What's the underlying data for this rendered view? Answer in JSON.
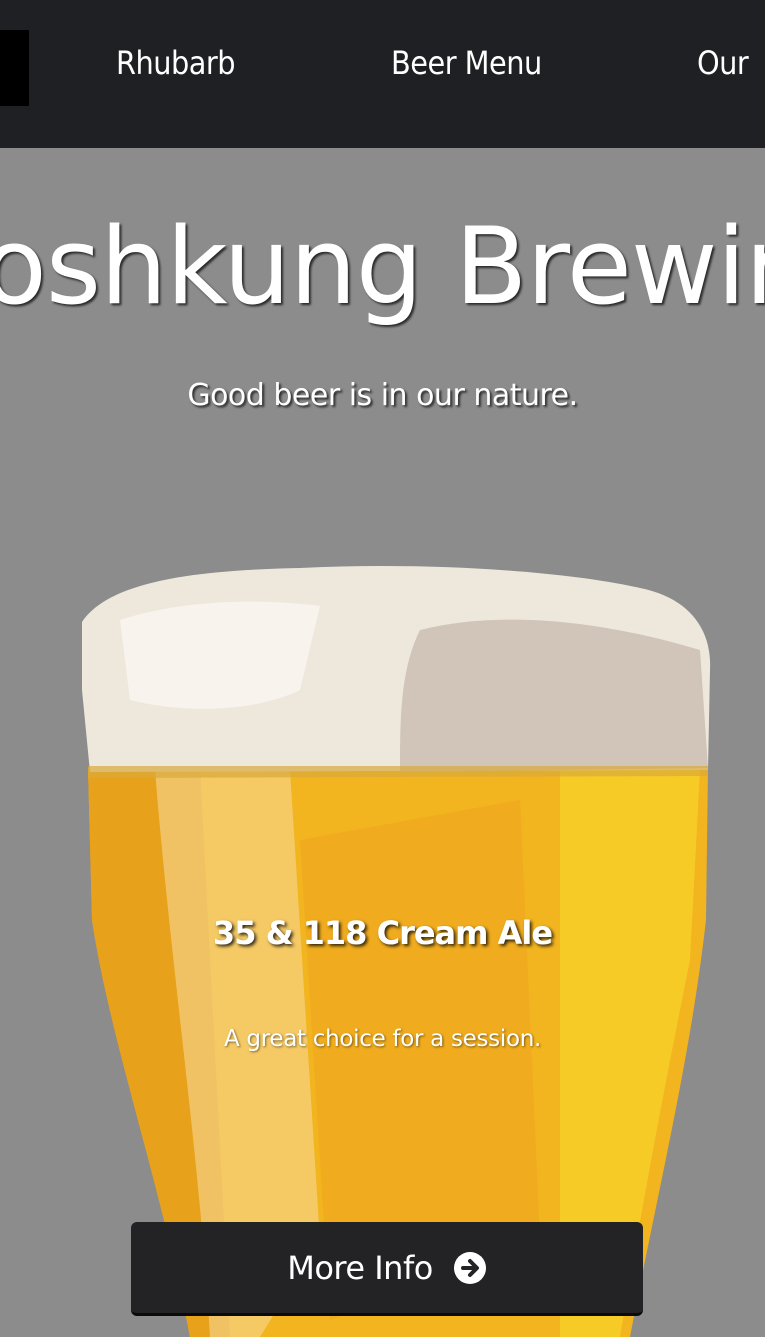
{
  "nav": {
    "links": [
      "Rhubarb",
      "Beer Menu",
      "Our"
    ]
  },
  "hero": {
    "title": "oshkung Brewin",
    "tagline": "Good beer is in our nature."
  },
  "feature": {
    "beer_name": "35 & 118 Cream Ale",
    "description": "A great choice for a session.",
    "button_label": "More Info",
    "button_icon": "arrow-circle-right-icon"
  },
  "colors": {
    "navbar": "#1f2023",
    "page_background": "#8c8c8c",
    "button": "#232326",
    "beer": "#f2b41f",
    "foam": "#eee8dc"
  }
}
